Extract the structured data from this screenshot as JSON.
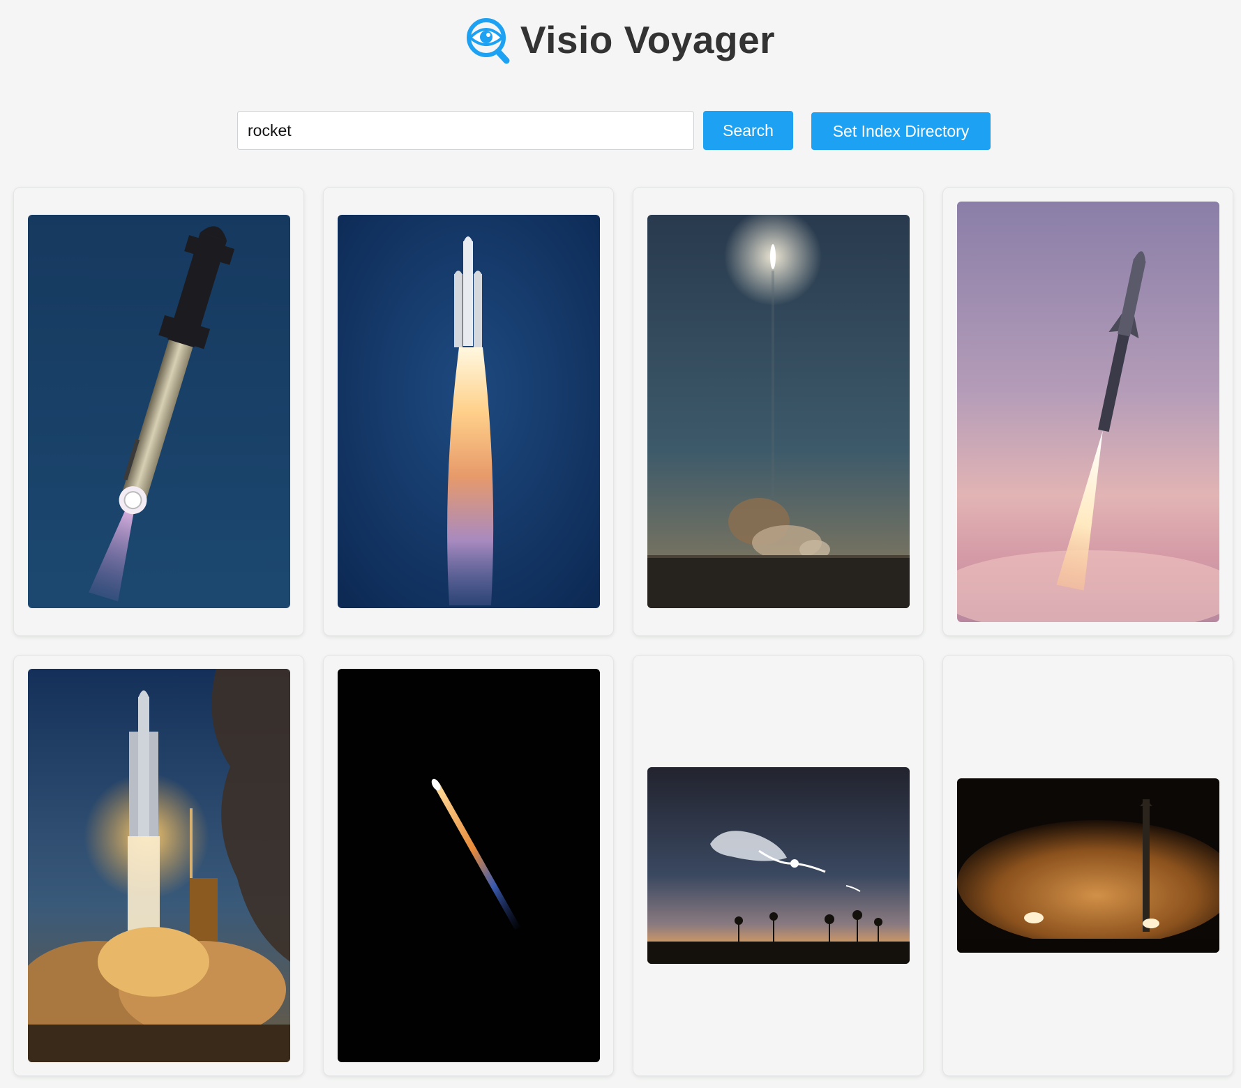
{
  "app": {
    "title": "Visio Voyager",
    "logo_icon": "eye-magnifier-icon",
    "accent_color": "#1da1f2"
  },
  "search": {
    "value": "rocket",
    "placeholder": "",
    "search_label": "Search",
    "index_label": "Set Index Directory"
  },
  "results": [
    {
      "name": "starship-booster-ascent-blue-sky",
      "aspect": "portrait"
    },
    {
      "name": "falcon-heavy-launch-blue-sky",
      "aspect": "portrait"
    },
    {
      "name": "distant-launch-dusk-smoke",
      "aspect": "portrait"
    },
    {
      "name": "starship-launch-pink-sunset",
      "aspect": "portrait"
    },
    {
      "name": "falcon-heavy-pad-clouds-golden",
      "aspect": "portrait"
    },
    {
      "name": "night-streak-black-sky",
      "aspect": "portrait"
    },
    {
      "name": "rocket-plume-twilight-palms",
      "aspect": "landscape"
    },
    {
      "name": "booster-landing-night-dust",
      "aspect": "landscape"
    }
  ]
}
